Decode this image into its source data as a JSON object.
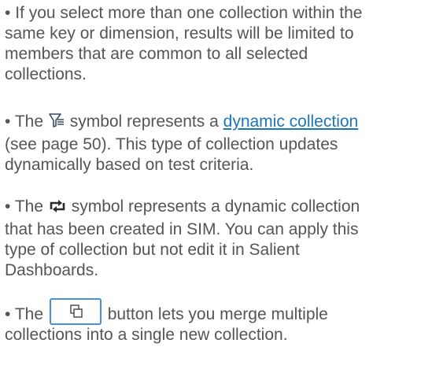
{
  "paragraphs": {
    "p1": {
      "bullet": "•",
      "lines": [
        "If you select more than one collection within the",
        "same key or dimension, results will be limited to",
        "members that are common to all selected",
        "collections."
      ]
    },
    "p2": {
      "bullet": "•",
      "pre": "The",
      "icon": "dynamic-collection-filter-icon",
      "mid": "symbol represents a",
      "link": "dynamic collection",
      "lines": [
        "(see page 50). This type of collection updates",
        "dynamically based on test criteria."
      ]
    },
    "p3": {
      "bullet": "•",
      "pre": "The",
      "icon": "sim-collection-loop-icon",
      "mid": "symbol represents a dynamic collection",
      "lines": [
        "that has been created in SIM. You can apply this",
        "type of collection but not edit it in Salient",
        "Dashboards."
      ]
    },
    "p4": {
      "bullet": "•",
      "pre": "The",
      "button_icon": "merge-collections-icon",
      "mid": "button lets you merge multiple",
      "lines": [
        "collections into a single new collection."
      ]
    }
  },
  "colors": {
    "text": "#555555",
    "link": "#1b75bc",
    "button_border": "#4a90d9"
  }
}
